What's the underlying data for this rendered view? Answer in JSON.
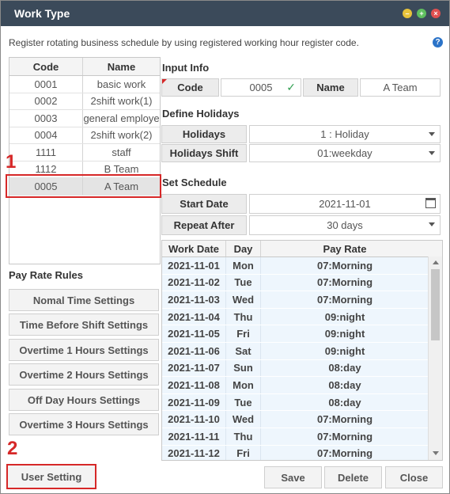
{
  "window": {
    "title": "Work Type",
    "min_icon": "minimize-icon",
    "max_icon": "maximize-icon",
    "close_icon": "close-icon"
  },
  "description": "Register rotating business schedule by using registered working hour register code.",
  "help_icon": "?",
  "code_list": {
    "headers": [
      "Code",
      "Name"
    ],
    "rows": [
      {
        "code": "0001",
        "name": "basic work"
      },
      {
        "code": "0002",
        "name": "2shift work(1)"
      },
      {
        "code": "0003",
        "name": "general employe"
      },
      {
        "code": "0004",
        "name": "2shift work(2)"
      },
      {
        "code": "1111",
        "name": "staff"
      },
      {
        "code": "1112",
        "name": "B Team"
      },
      {
        "code": "0005",
        "name": "A Team"
      }
    ],
    "selected_index": 6
  },
  "annotations": {
    "step1": "1",
    "step2": "2"
  },
  "input_info": {
    "section": "Input Info",
    "code_label": "Code",
    "code_value": "0005",
    "name_label": "Name",
    "name_value": "A Team"
  },
  "define_holidays": {
    "section": "Define Holidays",
    "holidays_label": "Holidays",
    "holidays_value": "1 : Holiday",
    "shift_label": "Holidays Shift",
    "shift_value": "01:weekday"
  },
  "set_schedule": {
    "section": "Set Schedule",
    "start_label": "Start Date",
    "start_value": "2021-11-01",
    "repeat_label": "Repeat After",
    "repeat_value": "30 days"
  },
  "schedule": {
    "headers": [
      "Work Date",
      "Day",
      "Pay Rate"
    ],
    "rows": [
      [
        "2021-11-01",
        "Mon",
        "07:Morning"
      ],
      [
        "2021-11-02",
        "Tue",
        "07:Morning"
      ],
      [
        "2021-11-03",
        "Wed",
        "07:Morning"
      ],
      [
        "2021-11-04",
        "Thu",
        "09:night"
      ],
      [
        "2021-11-05",
        "Fri",
        "09:night"
      ],
      [
        "2021-11-06",
        "Sat",
        "09:night"
      ],
      [
        "2021-11-07",
        "Sun",
        "08:day"
      ],
      [
        "2021-11-08",
        "Mon",
        "08:day"
      ],
      [
        "2021-11-09",
        "Tue",
        "08:day"
      ],
      [
        "2021-11-10",
        "Wed",
        "07:Morning"
      ],
      [
        "2021-11-11",
        "Thu",
        "07:Morning"
      ],
      [
        "2021-11-12",
        "Fri",
        "07:Morning"
      ]
    ]
  },
  "pay_rate_rules": {
    "section": "Pay Rate Rules",
    "buttons": [
      "Nomal Time Settings",
      "Time Before Shift Settings",
      "Overtime 1 Hours Settings",
      "Overtime 2 Hours Settings",
      "Off Day Hours Settings",
      "Overtime 3 Hours Settings"
    ]
  },
  "footer": {
    "user_setting": "User Setting",
    "save": "Save",
    "delete": "Delete",
    "close": "Close"
  },
  "colors": {
    "titlebar": "#3b4a5a",
    "highlight": "#d62828",
    "grid_row": "#eef6fd"
  }
}
